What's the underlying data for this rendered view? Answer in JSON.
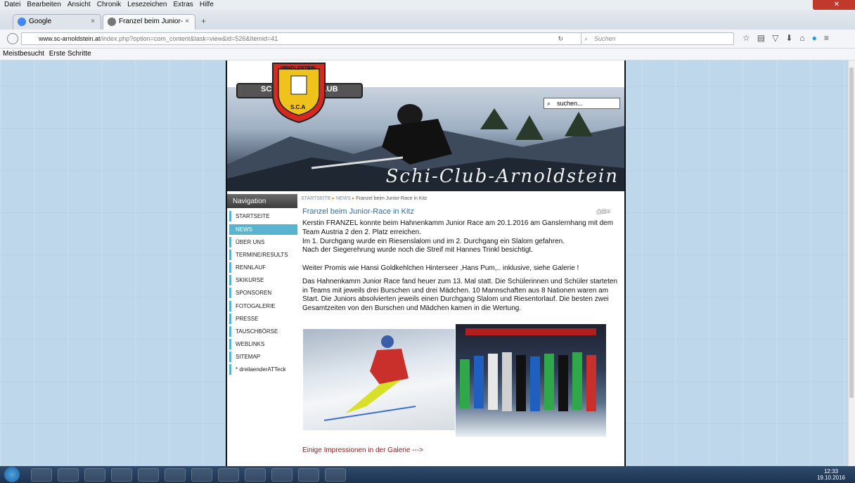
{
  "menubar": [
    "Datei",
    "Bearbeiten",
    "Ansicht",
    "Chronik",
    "Lesezeichen",
    "Extras",
    "Hilfe"
  ],
  "tabs": [
    {
      "label": "Google",
      "close": "×"
    },
    {
      "label": "Franzel beim Junior-Race i...",
      "close": "×"
    }
  ],
  "new_tab": "+",
  "address": {
    "host": "www.sc-arnoldstein.at",
    "path": "/index.php?option=com_content&task=view&id=526&Itemid=41"
  },
  "search": {
    "placeholder": "Suchen"
  },
  "bookmarks": [
    "Meistbesucht",
    "Erste Schritte"
  ],
  "site": {
    "logo_top": "ARNOLDSTEIN",
    "logo_left": "SCHI",
    "logo_right": "CLUB",
    "logo_bottom": "S.C.A",
    "banner_title": "Schi-Club-Arnoldstein",
    "search_placeholder": "suchen..."
  },
  "nav": {
    "header": "Navigation",
    "items": [
      "STARTSEITE",
      "NEWS",
      "ÜBER UNS",
      "TERMINE/RESULTS",
      "RENNLAUF",
      "SKIKURSE",
      "SPONSOREN",
      "FOTOGALERIE",
      "PRESSE",
      "TAUSCHBÖRSE",
      "WEBLINKS",
      "SITEMAP",
      "* dreilaenderATTeck"
    ],
    "active": "NEWS"
  },
  "breadcrumb": {
    "home": "STARTSEITE",
    "news": "NEWS",
    "current": "Franzel beim Junior-Race in Kitz",
    "sep": "▸"
  },
  "article": {
    "title": "Franzel beim Junior-Race in Kitz",
    "p1": "Kerstin FRANZEL konnte beim Hahnenkamm Junior Race am 20.1.2016 am Ganslernhang mit dem Team Austria 2 den 2. Platz erreichen.",
    "p2": "Im 1. Durchgang wurde ein Riesenslalom und im 2. Durchgang ein Slalom gefahren.",
    "p3": "Nach der Siegerehrung wurde noch die Streif mit Hannes Trinkl besichtigt.",
    "p4": "Weiter Promis wie Hansi Goldkehlchen Hinterseer ,Hans Pum,.. inklusive, siehe Galerie !",
    "p5": "Das Hahnenkamm Junior Race fand heuer zum 13. Mal statt. Die Schülerinnen und Schüler starteten in Teams mit jeweils drei Burschen und drei Mädchen. 10 Mannschaften aus 8 Nationen waren am Start. Die Juniors absolvierten jeweils einen Durchgang Slalom und Riesentorlauf. Die besten zwei Gesamtzeiten von den Burschen und Mädchen kamen in die Wertung.",
    "gallery_link": "Einige Impressionen in der Galerie --->"
  },
  "clock": {
    "time": "12:33",
    "date": "19.10.2016"
  }
}
